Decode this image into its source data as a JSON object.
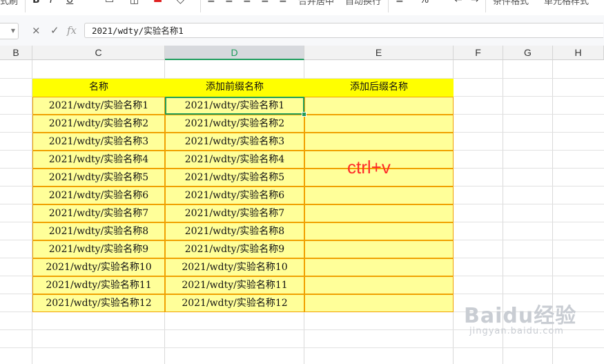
{
  "toolbar": {
    "items": [
      "式刷",
      "B",
      "I",
      "U",
      "合并居中",
      "自动换行",
      "条件格式",
      "单元格样式"
    ]
  },
  "formula_bar": {
    "cancel_icon": "×",
    "confirm_icon": "✓",
    "fx_label": "fx",
    "content": "2021/wdty/实验名称1"
  },
  "columns": {
    "B": "B",
    "C": "C",
    "D": "D",
    "E": "E",
    "F": "F",
    "G": "G",
    "H": "H"
  },
  "table": {
    "headers": [
      "名称",
      "添加前缀名称",
      "添加后缀名称"
    ],
    "col_c": [
      "2021/wdty/实验名称1",
      "2021/wdty/实验名称2",
      "2021/wdty/实验名称3",
      "2021/wdty/实验名称4",
      "2021/wdty/实验名称5",
      "2021/wdty/实验名称6",
      "2021/wdty/实验名称7",
      "2021/wdty/实验名称8",
      "2021/wdty/实验名称9",
      "2021/wdty/实验名称10",
      "2021/wdty/实验名称11",
      "2021/wdty/实验名称12"
    ],
    "col_d": [
      "2021/wdty/实验名称1",
      "2021/wdty/实验名称2",
      "2021/wdty/实验名称3",
      "2021/wdty/实验名称4",
      "2021/wdty/实验名称5",
      "2021/wdty/实验名称6",
      "2021/wdty/实验名称7",
      "2021/wdty/实验名称8",
      "2021/wdty/实验名称9",
      "2021/wdty/实验名称10",
      "2021/wdty/实验名称11",
      "2021/wdty/实验名称12"
    ]
  },
  "annotation": "ctrl+v",
  "watermark": {
    "logo": "Baidu经验",
    "url": "jingyan.baidu.com"
  },
  "colors": {
    "header_fill": "#ffff00",
    "data_fill": "#ffff99",
    "border": "#f0a000",
    "selection": "#1f9d58",
    "annotation": "#ff2a2a"
  }
}
